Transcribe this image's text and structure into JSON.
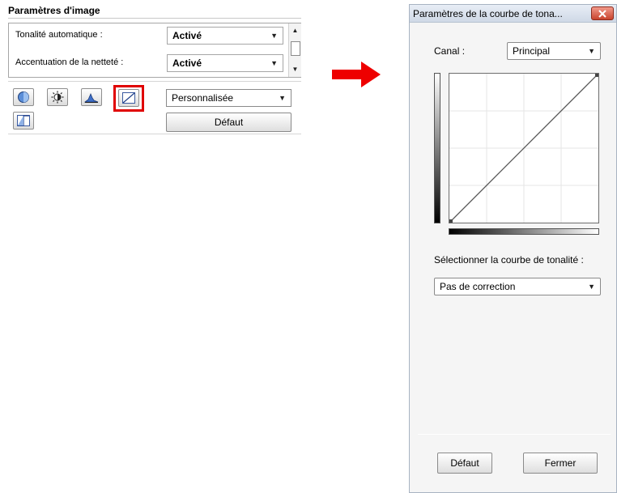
{
  "left_panel": {
    "title": "Paramètres d'image",
    "rows": [
      {
        "label": "Tonalité automatique :",
        "value": "Activé"
      },
      {
        "label": "Accentuation de la netteté :",
        "value": "Activé"
      }
    ],
    "preset_value": "Personnalisée",
    "default_button": "Défaut",
    "tool_buttons": [
      "saturation-color-balance-icon",
      "brightness-contrast-icon",
      "histogram-icon",
      "tone-curve-icon",
      "threshold-icon"
    ],
    "highlighted_tool": "tone-curve-icon",
    "highlight_color": "#e00000"
  },
  "arrow": {
    "color": "#ee0000",
    "icon": "right-arrow-icon"
  },
  "dialog": {
    "title": "Paramètres de la courbe de tona...",
    "close_icon": "close-icon",
    "channel_label": "Canal :",
    "channel_value": "Principal",
    "curve_select_label": "Sélectionner la courbe de tonalité :",
    "curve_value": "Pas de correction",
    "default_button": "Défaut",
    "close_button": "Fermer",
    "close_button_color": "#c8432d"
  }
}
